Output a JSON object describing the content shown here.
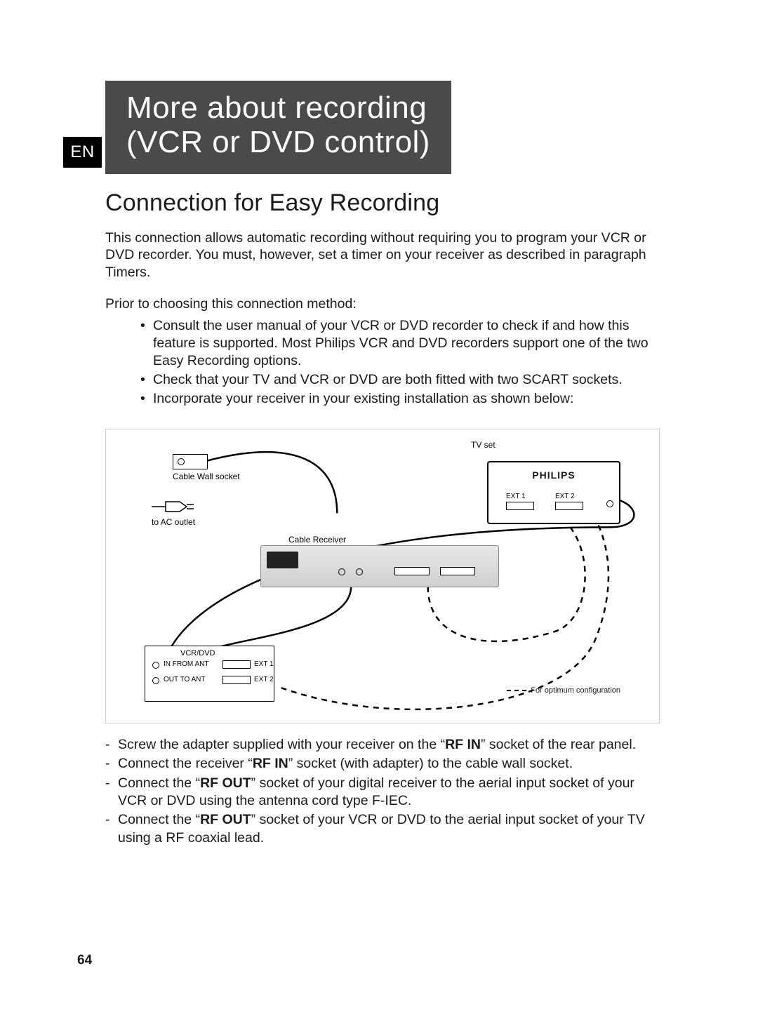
{
  "lang": "EN",
  "title": {
    "line1": "More about recording",
    "line2": "(VCR or DVD control)"
  },
  "section_heading": "Connection for Easy Recording",
  "intro": "This connection allows automatic recording without requiring you to program your VCR or DVD recorder. You must, however, set a timer on your receiver as described in paragraph Timers.",
  "pre_list_text": "Prior to choosing this connection method:",
  "bullets": [
    "Consult the user manual of your VCR or DVD recorder to check if and how this feature is supported. Most Philips VCR and DVD recorders support one of the two Easy Recording options.",
    "Check that your TV and VCR or DVD are both fitted with two SCART sockets.",
    "Incorporate your receiver in your existing installation as shown below:"
  ],
  "diagram": {
    "tv_label": "TV set",
    "tv_brand": "PHILIPS",
    "ext1": "EXT 1",
    "ext2": "EXT 2",
    "wall_label": "Cable Wall socket",
    "ac_label": "to AC outlet",
    "receiver_label": "Cable Receiver",
    "vcr_label": "VCR/DVD",
    "in_ant": "IN FROM ANT",
    "out_ant": "OUT TO ANT",
    "legend": "For optimum configuration"
  },
  "steps": [
    {
      "pre": "Screw the adapter supplied with your receiver on the “",
      "bold": "RF IN",
      "post": "” socket of the rear panel."
    },
    {
      "pre": "Connect the receiver “",
      "bold": "RF IN",
      "post": "” socket (with adapter) to the cable wall socket."
    },
    {
      "pre": "Connect the “",
      "bold": "RF OUT",
      "post": "” socket of your digital receiver to the aerial input socket of your VCR or DVD using the antenna cord type F-IEC."
    },
    {
      "pre": "Connect the “",
      "bold": "RF OUT",
      "post": "” socket of your VCR or DVD to the aerial input socket of your TV using a RF coaxial lead."
    }
  ],
  "page_number": "64"
}
